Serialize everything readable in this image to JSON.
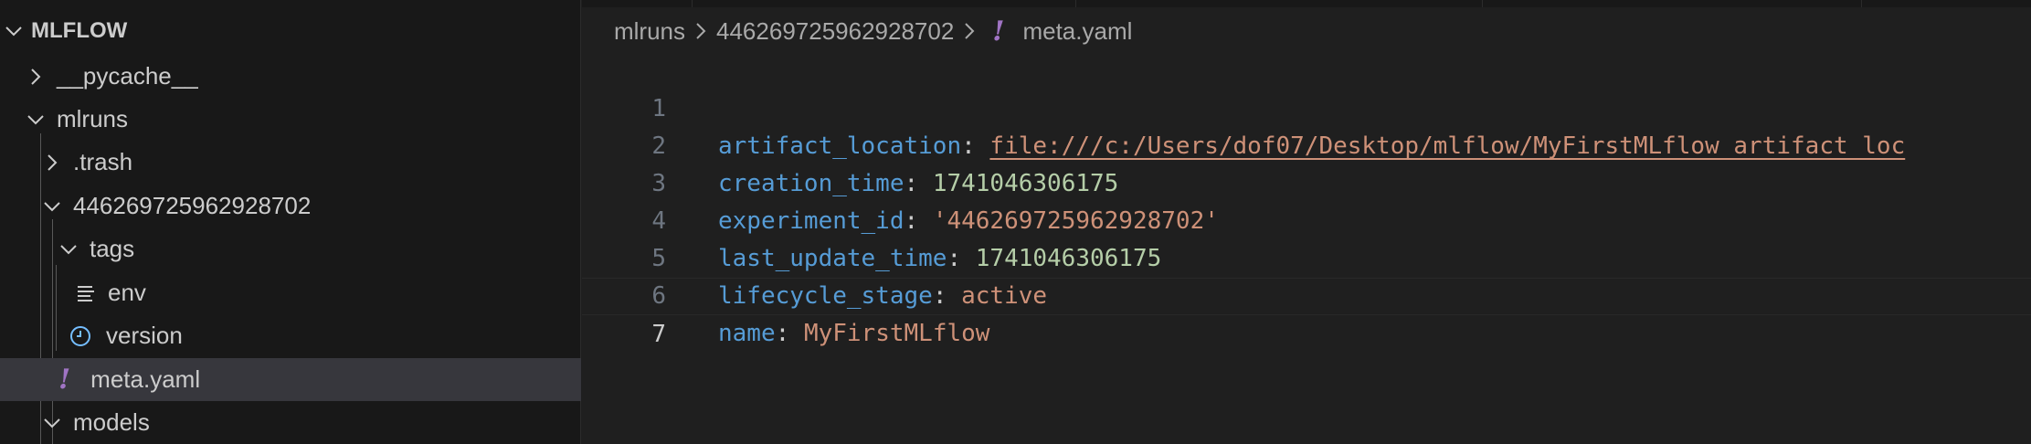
{
  "explorer": {
    "root_label": "MLFLOW",
    "items": [
      {
        "label": "__pycache__"
      },
      {
        "label": "mlruns"
      },
      {
        "label": ".trash"
      },
      {
        "label": "446269725962928702"
      },
      {
        "label": "tags"
      },
      {
        "label": "env"
      },
      {
        "label": "version"
      },
      {
        "label": "meta.yaml"
      },
      {
        "label": "models"
      }
    ]
  },
  "breadcrumb": {
    "segments": [
      "mlruns",
      "446269725962928702",
      "meta.yaml"
    ]
  },
  "editor": {
    "lines": [
      {
        "num": "1",
        "key": "artifact_location",
        "sep": ": ",
        "value": "file:///c:/Users/dof07/Desktop/mlflow/MyFirstMLflow_artifact_loc"
      },
      {
        "num": "2",
        "key": "creation_time",
        "sep": ": ",
        "value": "1741046306175"
      },
      {
        "num": "3",
        "key": "experiment_id",
        "sep": ": ",
        "value": "'446269725962928702'"
      },
      {
        "num": "4",
        "key": "last_update_time",
        "sep": ": ",
        "value": "1741046306175"
      },
      {
        "num": "5",
        "key": "lifecycle_stage",
        "sep": ": ",
        "value": "active"
      },
      {
        "num": "6",
        "key": "name",
        "sep": ": ",
        "value": "MyFirstMLflow"
      },
      {
        "num": "7",
        "key": "",
        "sep": "",
        "value": ""
      }
    ]
  },
  "colors": {
    "yaml_key": "#569cd6",
    "yaml_number": "#b5cea8",
    "yaml_string": "#ce9178",
    "yaml_icon": "#a074c4",
    "selection": "#37373d"
  }
}
